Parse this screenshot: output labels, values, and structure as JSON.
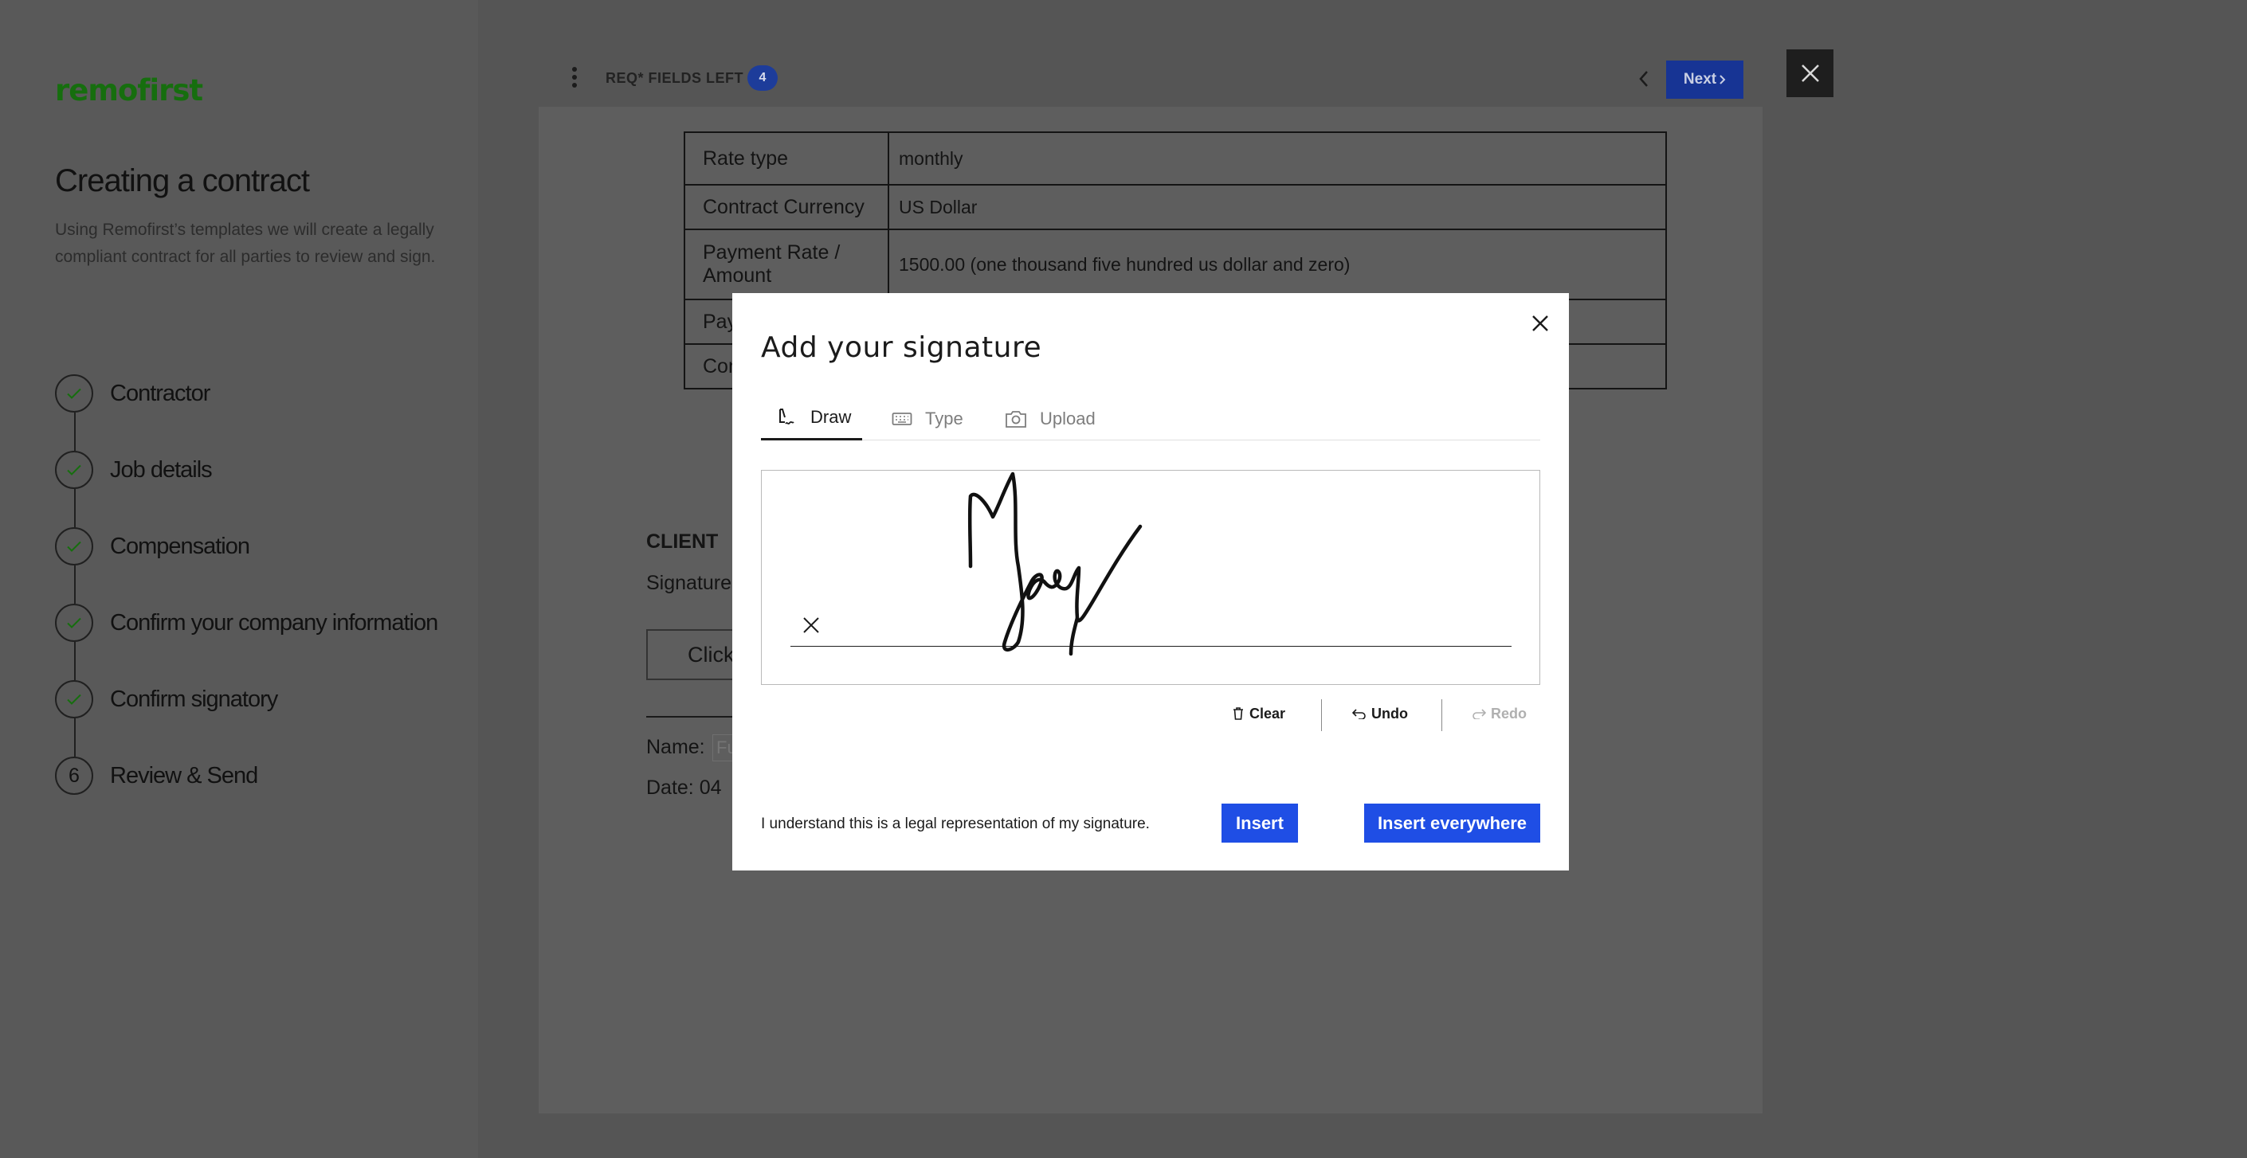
{
  "sidebar": {
    "logo": "remofirst",
    "heading": "Creating a contract",
    "description": "Using Remofirst’s templates we will create a legally compliant contract for all parties to review and sign.",
    "steps": [
      {
        "label": "Contractor",
        "status": "done"
      },
      {
        "label": "Job details",
        "status": "done"
      },
      {
        "label": "Compensation",
        "status": "done"
      },
      {
        "label": "Confirm your company information",
        "status": "done"
      },
      {
        "label": "Confirm signatory",
        "status": "done"
      },
      {
        "label": "Review & Send",
        "status": "current",
        "number": "6"
      }
    ]
  },
  "viewer": {
    "required_label": "REQ* FIELDS LEFT",
    "required_count": "4",
    "next_label": "Next",
    "table": [
      {
        "key": "Rate type",
        "value": "monthly"
      },
      {
        "key": "Contract Currency",
        "value": "US Dollar"
      },
      {
        "key": "Payment Rate / Amount",
        "value": "1500.00 (one thousand five hundred us dollar and zero)"
      },
      {
        "key": "Pay",
        "value": ""
      },
      {
        "key": "Con",
        "value": ""
      }
    ],
    "client_title": "CLIENT",
    "signature_label": "Signature",
    "click_to_sign": "Click",
    "name_label": "Name:",
    "name_placeholder": "Fu",
    "date_label": "Date: 04"
  },
  "modal": {
    "title": "Add your signature",
    "tabs": [
      {
        "label": "Draw",
        "icon": "draw-icon",
        "active": true
      },
      {
        "label": "Type",
        "icon": "keyboard-icon",
        "active": false
      },
      {
        "label": "Upload",
        "icon": "camera-icon",
        "active": false
      }
    ],
    "actions": {
      "clear": "Clear",
      "undo": "Undo",
      "redo": "Redo"
    },
    "legal_text": "I understand this is a legal representation of my signature.",
    "insert_label": "Insert",
    "insert_everywhere_label": "Insert everywhere"
  },
  "colors": {
    "brand_green": "#166e0e",
    "primary_blue": "#1f4ee5",
    "overlay": "#555555"
  }
}
